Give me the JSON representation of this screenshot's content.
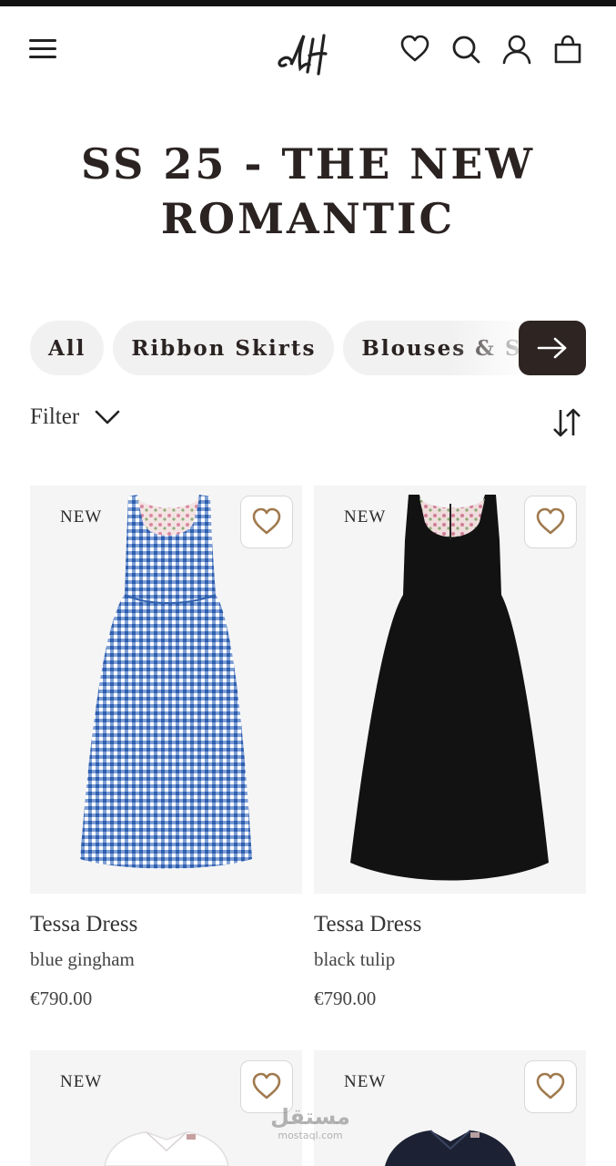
{
  "header": {
    "menu_icon": "hamburger-menu-icon",
    "logo_text": "LH",
    "icons": [
      "heart-icon",
      "search-icon",
      "user-icon",
      "shopping-bag-icon"
    ]
  },
  "page": {
    "title": "SS 25 - THE NEW ROMANTIC"
  },
  "categories": {
    "chips": [
      "All",
      "Ribbon Skirts",
      "Blouses & Shi"
    ],
    "next_icon": "arrow-right-icon"
  },
  "toolbar": {
    "filter_label": "Filter",
    "filter_icon": "chevron-down-icon",
    "sort_icon": "sort-arrows-icon"
  },
  "products": [
    {
      "badge": "NEW",
      "name": "Tessa Dress",
      "color": "blue gingham",
      "price": "€790.00"
    },
    {
      "badge": "NEW",
      "name": "Tessa Dress",
      "color": "black tulip",
      "price": "€790.00"
    },
    {
      "badge": "NEW",
      "name": "",
      "color": "",
      "price": ""
    },
    {
      "badge": "NEW",
      "name": "",
      "color": "",
      "price": ""
    }
  ],
  "watermark": {
    "arabic": "مستقل",
    "latin": "mostaql.com"
  },
  "colors": {
    "dark_button": "#2e2422",
    "chip_bg": "#f1f1f1",
    "card_bg": "#f5f5f5",
    "wishlist_heart": "#a07a4e"
  }
}
